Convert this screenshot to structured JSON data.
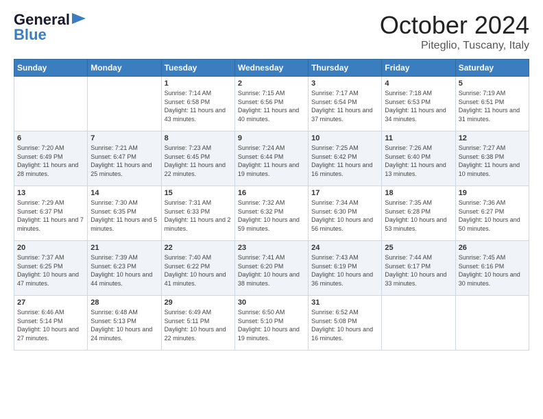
{
  "logo": {
    "text1": "General",
    "text2": "Blue"
  },
  "title": "October 2024",
  "subtitle": "Piteglio, Tuscany, Italy",
  "days_header": [
    "Sunday",
    "Monday",
    "Tuesday",
    "Wednesday",
    "Thursday",
    "Friday",
    "Saturday"
  ],
  "weeks": [
    [
      {
        "day": "",
        "info": ""
      },
      {
        "day": "",
        "info": ""
      },
      {
        "day": "1",
        "info": "Sunrise: 7:14 AM\nSunset: 6:58 PM\nDaylight: 11 hours and 43 minutes."
      },
      {
        "day": "2",
        "info": "Sunrise: 7:15 AM\nSunset: 6:56 PM\nDaylight: 11 hours and 40 minutes."
      },
      {
        "day": "3",
        "info": "Sunrise: 7:17 AM\nSunset: 6:54 PM\nDaylight: 11 hours and 37 minutes."
      },
      {
        "day": "4",
        "info": "Sunrise: 7:18 AM\nSunset: 6:53 PM\nDaylight: 11 hours and 34 minutes."
      },
      {
        "day": "5",
        "info": "Sunrise: 7:19 AM\nSunset: 6:51 PM\nDaylight: 11 hours and 31 minutes."
      }
    ],
    [
      {
        "day": "6",
        "info": "Sunrise: 7:20 AM\nSunset: 6:49 PM\nDaylight: 11 hours and 28 minutes."
      },
      {
        "day": "7",
        "info": "Sunrise: 7:21 AM\nSunset: 6:47 PM\nDaylight: 11 hours and 25 minutes."
      },
      {
        "day": "8",
        "info": "Sunrise: 7:23 AM\nSunset: 6:45 PM\nDaylight: 11 hours and 22 minutes."
      },
      {
        "day": "9",
        "info": "Sunrise: 7:24 AM\nSunset: 6:44 PM\nDaylight: 11 hours and 19 minutes."
      },
      {
        "day": "10",
        "info": "Sunrise: 7:25 AM\nSunset: 6:42 PM\nDaylight: 11 hours and 16 minutes."
      },
      {
        "day": "11",
        "info": "Sunrise: 7:26 AM\nSunset: 6:40 PM\nDaylight: 11 hours and 13 minutes."
      },
      {
        "day": "12",
        "info": "Sunrise: 7:27 AM\nSunset: 6:38 PM\nDaylight: 11 hours and 10 minutes."
      }
    ],
    [
      {
        "day": "13",
        "info": "Sunrise: 7:29 AM\nSunset: 6:37 PM\nDaylight: 11 hours and 7 minutes."
      },
      {
        "day": "14",
        "info": "Sunrise: 7:30 AM\nSunset: 6:35 PM\nDaylight: 11 hours and 5 minutes."
      },
      {
        "day": "15",
        "info": "Sunrise: 7:31 AM\nSunset: 6:33 PM\nDaylight: 11 hours and 2 minutes."
      },
      {
        "day": "16",
        "info": "Sunrise: 7:32 AM\nSunset: 6:32 PM\nDaylight: 10 hours and 59 minutes."
      },
      {
        "day": "17",
        "info": "Sunrise: 7:34 AM\nSunset: 6:30 PM\nDaylight: 10 hours and 56 minutes."
      },
      {
        "day": "18",
        "info": "Sunrise: 7:35 AM\nSunset: 6:28 PM\nDaylight: 10 hours and 53 minutes."
      },
      {
        "day": "19",
        "info": "Sunrise: 7:36 AM\nSunset: 6:27 PM\nDaylight: 10 hours and 50 minutes."
      }
    ],
    [
      {
        "day": "20",
        "info": "Sunrise: 7:37 AM\nSunset: 6:25 PM\nDaylight: 10 hours and 47 minutes."
      },
      {
        "day": "21",
        "info": "Sunrise: 7:39 AM\nSunset: 6:23 PM\nDaylight: 10 hours and 44 minutes."
      },
      {
        "day": "22",
        "info": "Sunrise: 7:40 AM\nSunset: 6:22 PM\nDaylight: 10 hours and 41 minutes."
      },
      {
        "day": "23",
        "info": "Sunrise: 7:41 AM\nSunset: 6:20 PM\nDaylight: 10 hours and 38 minutes."
      },
      {
        "day": "24",
        "info": "Sunrise: 7:43 AM\nSunset: 6:19 PM\nDaylight: 10 hours and 36 minutes."
      },
      {
        "day": "25",
        "info": "Sunrise: 7:44 AM\nSunset: 6:17 PM\nDaylight: 10 hours and 33 minutes."
      },
      {
        "day": "26",
        "info": "Sunrise: 7:45 AM\nSunset: 6:16 PM\nDaylight: 10 hours and 30 minutes."
      }
    ],
    [
      {
        "day": "27",
        "info": "Sunrise: 6:46 AM\nSunset: 5:14 PM\nDaylight: 10 hours and 27 minutes."
      },
      {
        "day": "28",
        "info": "Sunrise: 6:48 AM\nSunset: 5:13 PM\nDaylight: 10 hours and 24 minutes."
      },
      {
        "day": "29",
        "info": "Sunrise: 6:49 AM\nSunset: 5:11 PM\nDaylight: 10 hours and 22 minutes."
      },
      {
        "day": "30",
        "info": "Sunrise: 6:50 AM\nSunset: 5:10 PM\nDaylight: 10 hours and 19 minutes."
      },
      {
        "day": "31",
        "info": "Sunrise: 6:52 AM\nSunset: 5:08 PM\nDaylight: 10 hours and 16 minutes."
      },
      {
        "day": "",
        "info": ""
      },
      {
        "day": "",
        "info": ""
      }
    ]
  ]
}
